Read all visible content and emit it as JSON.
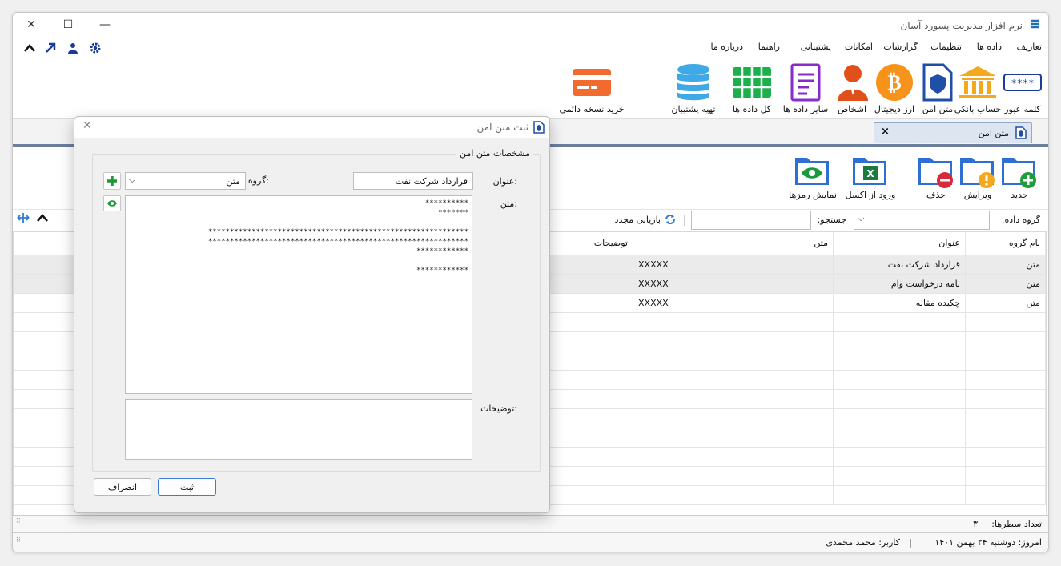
{
  "app": {
    "title": "نرم افزار مدیریت پسورد آسان"
  },
  "menu": [
    "تعاریف",
    "داده ها",
    "تنظیمات",
    "گزارشات",
    "امکانات",
    "پشتیبانی",
    "راهنما",
    "درباره ما"
  ],
  "ribbon": [
    "کلمه عبور",
    "حساب بانکی",
    "متن امن",
    "ارز دیجیتال",
    "اشخاص",
    "سایر داده ها",
    "کل داده ها",
    "تهیه پشتیبان",
    "خرید نسخه دائمی"
  ],
  "doc_tab": {
    "label": "متن امن",
    "close": "×"
  },
  "toolbar": {
    "new": "جدید",
    "edit": "ویرایش",
    "delete": "حذف",
    "import_excel": "ورود از اکسل",
    "show_passwords": "نمایش رمزها"
  },
  "filter": {
    "group_label": "گروه داده:",
    "search_label": "جستجو:",
    "refresh": "بازیابی مجدد"
  },
  "grid": {
    "columns": [
      "نام گروه",
      "عنوان",
      "متن",
      "توضیحات"
    ],
    "rows": [
      [
        "متن",
        "قرارداد شرکت نفت",
        "XXXXX",
        ""
      ],
      [
        "متن",
        "نامه درخواست وام",
        "XXXXX",
        ""
      ],
      [
        "متن",
        "چکیده مقاله",
        "XXXXX",
        ""
      ]
    ]
  },
  "row_count": {
    "label": "تعداد سطرها:",
    "value": "۳"
  },
  "status": {
    "today": "امروز: دوشنبه ۲۴ بهمن ۱۴۰۱",
    "sep": "|",
    "user": "کاربر: محمد محمدی"
  },
  "dialog": {
    "title": "ثبت متن امن",
    "group_title": "مشخصات متن امن",
    "title_label": "عنوان:",
    "title_value": "قرارداد شرکت نفت",
    "group_label": "گروه:",
    "group_value": "متن",
    "text_label": "متن:",
    "text_lines": [
      "**********",
      "*******",
      "",
      "************************************************************",
      "************************************************************",
      "************",
      "",
      "************"
    ],
    "desc_label": "توضیحات:",
    "save": "ثبت",
    "cancel": "انصراف"
  },
  "colors": {
    "accent": "#2e7dd7",
    "folder": "#2f6fd4",
    "bitcoin": "#f7931a",
    "bank": "#f4a81d",
    "person": "#e0501b",
    "doc": "#8a2ac9",
    "grid": "#1bb14a",
    "db": "#3ea9e6",
    "card": "#f26a2d"
  }
}
